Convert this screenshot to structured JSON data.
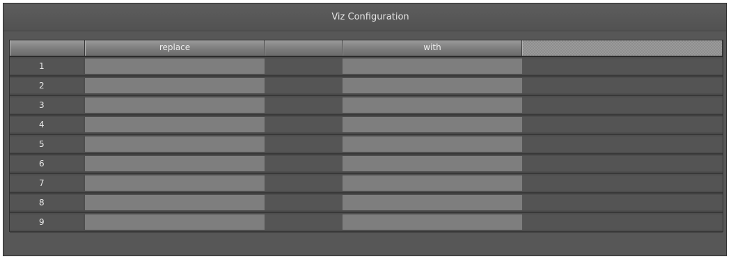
{
  "window": {
    "title": "Viz Configuration"
  },
  "table": {
    "columns": [
      {
        "label": ""
      },
      {
        "label": "replace"
      },
      {
        "label": ""
      },
      {
        "label": "with"
      },
      {
        "label": ""
      }
    ],
    "rows": [
      {
        "index": "1",
        "replace": "",
        "with": ""
      },
      {
        "index": "2",
        "replace": "",
        "with": ""
      },
      {
        "index": "3",
        "replace": "",
        "with": ""
      },
      {
        "index": "4",
        "replace": "",
        "with": ""
      },
      {
        "index": "5",
        "replace": "",
        "with": ""
      },
      {
        "index": "6",
        "replace": "",
        "with": ""
      },
      {
        "index": "7",
        "replace": "",
        "with": ""
      },
      {
        "index": "8",
        "replace": "",
        "with": ""
      },
      {
        "index": "9",
        "replace": "",
        "with": ""
      }
    ]
  },
  "colors": {
    "window_bg": "#575757",
    "field_bg": "#7e7e7e",
    "header_bg": "#8a8a8a",
    "text": "#e6e6e6"
  }
}
